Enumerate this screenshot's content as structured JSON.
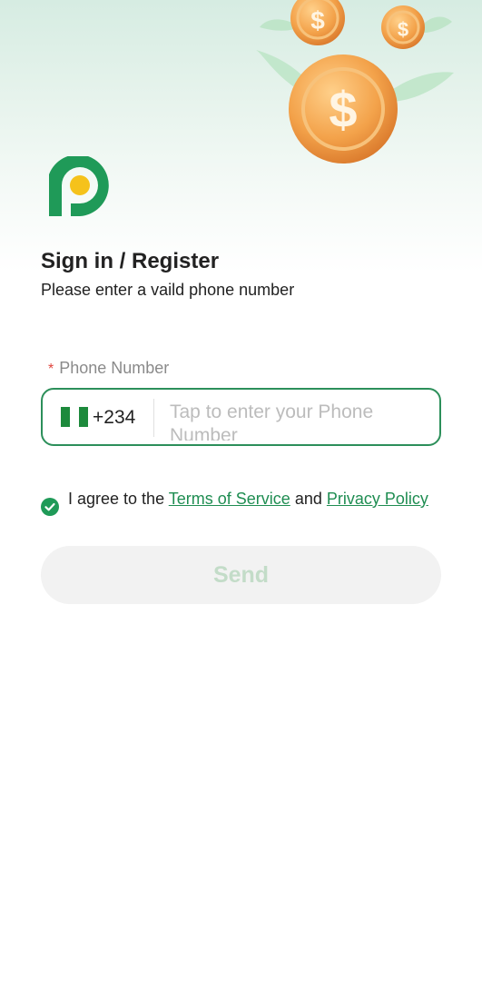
{
  "auth": {
    "title": "Sign in / Register",
    "subtitle": "Please enter a vaild phone number"
  },
  "phone": {
    "required_mark": "*",
    "label": "Phone Number",
    "country_code": "+234",
    "placeholder": "Tap to enter your Phone Number"
  },
  "agreement": {
    "prefix": "I agree to the",
    "terms": "Terms of Service",
    "and": "and",
    "privacy": "Privacy Policy"
  },
  "send_label": "Send",
  "colors": {
    "accent": "#1f9a58",
    "border": "#2c8f5a",
    "required": "#e0453e",
    "flag_green": "#1d8a3c",
    "coin": "#f0a046"
  },
  "icons": {
    "logo": "app-logo",
    "flag": "nigeria-flag-icon",
    "check": "check-circle-icon",
    "coins": "flying-dollar-coins"
  }
}
